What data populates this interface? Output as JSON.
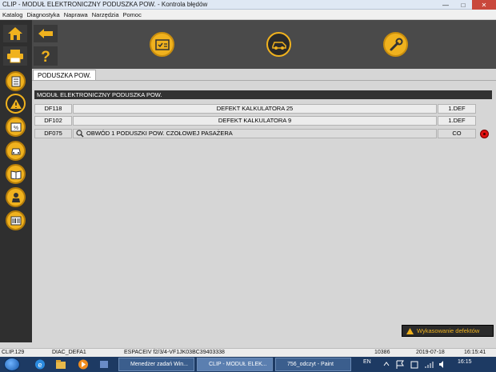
{
  "window": {
    "title": "CLIP - MODUŁ ELEKTRONICZNY PODUSZKA POW. - Kontrola błędów",
    "min": "—",
    "max": "□",
    "close": "✕"
  },
  "menu": [
    "Katalog",
    "Diagnostyka",
    "Naprawa",
    "Narzędzia",
    "Pomoc"
  ],
  "tab": {
    "label": "PODUSZKA POW."
  },
  "module_header": "MODUŁ ELEKTRONICZNY PODUSZKA POW.",
  "faults": [
    {
      "code": "DF118",
      "description": "DEFEKT KALKULATORA 25",
      "status": "1.DEF"
    },
    {
      "code": "DF102",
      "description": "DEFEKT KALKULATORA 9",
      "status": "1.DEF"
    },
    {
      "code": "DF075",
      "description": "OBWÓD 1 PODUSZKI POW. CZOŁOWEJ PASAŻERA",
      "status": "CO"
    }
  ],
  "clear_faults_label": "Wykasowanie defektów",
  "status": {
    "clip": "CLIP.129",
    "diac": "DIAC_DEFA1",
    "vehicle": "ESPACEIV f2/3/4-VF1JK03BC39403338",
    "code": "10386",
    "date": "2019-07-18",
    "time": "16:15:41"
  },
  "taskbar": {
    "apps": [
      {
        "label": "Menedżer zadań Win..."
      },
      {
        "label": "CLIP - MODUŁ ELEK..."
      },
      {
        "label": "756_odczyt - Paint"
      }
    ],
    "lang": "EN",
    "clock": "16:15"
  },
  "colors": {
    "accent": "#f0b21e",
    "toolbar": "#4a4a4a",
    "sidebar": "#2f2f2f",
    "alert": "#e01010"
  }
}
